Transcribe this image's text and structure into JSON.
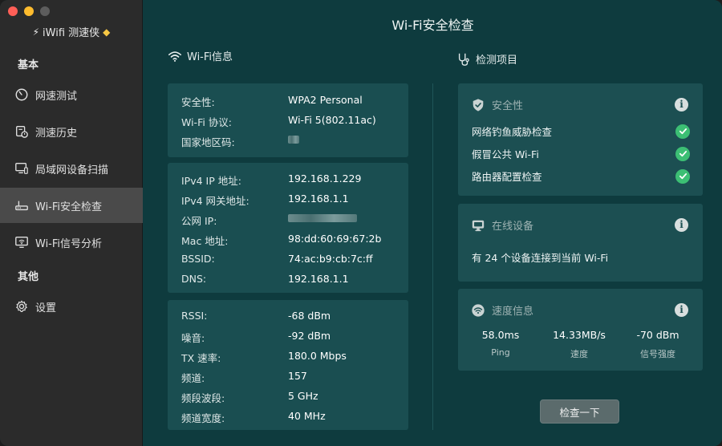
{
  "app": {
    "name": "iWifi 测速侠",
    "colors": {
      "sidebar": "#2b2b2b",
      "main": "#0e3b3e",
      "card": "#1a4e51",
      "ok": "#3cbf74",
      "accent_gold": "#f6c744"
    }
  },
  "sidebar": {
    "section_basic": "基本",
    "section_other": "其他",
    "items": [
      {
        "label": "网速测试",
        "icon": "speedometer-icon"
      },
      {
        "label": "测速历史",
        "icon": "history-icon"
      },
      {
        "label": "局域网设备扫描",
        "icon": "monitor-icon"
      },
      {
        "label": "Wi-Fi安全检查",
        "icon": "router-icon",
        "active": true
      },
      {
        "label": "Wi-Fi信号分析",
        "icon": "wifi-monitor-icon"
      }
    ],
    "settings": {
      "label": "设置",
      "icon": "gear-icon"
    }
  },
  "main": {
    "title": "Wi-Fi安全检查",
    "left_title": "Wi-Fi信息",
    "right_title": "检测项目",
    "info_groups": [
      [
        {
          "key": "安全性:",
          "value": "WPA2 Personal"
        },
        {
          "key": "Wi-Fi 协议:",
          "value": "Wi-Fi 5(802.11ac)"
        },
        {
          "key": "国家地区码:",
          "value": ""
        }
      ],
      [
        {
          "key": "IPv4 IP 地址:",
          "value": "192.168.1.229"
        },
        {
          "key": "IPv4 网关地址:",
          "value": "192.168.1.1"
        },
        {
          "key": "公网 IP:",
          "value": ""
        },
        {
          "key": "Mac 地址:",
          "value": "98:dd:60:69:67:2b"
        },
        {
          "key": "BSSID:",
          "value": "74:ac:b9:cb:7c:ff"
        },
        {
          "key": "DNS:",
          "value": "192.168.1.1"
        }
      ],
      [
        {
          "key": "RSSI:",
          "value": "-68 dBm"
        },
        {
          "key": "噪音:",
          "value": "-92 dBm"
        },
        {
          "key": "TX 速率:",
          "value": "180.0 Mbps"
        },
        {
          "key": "频道:",
          "value": "157"
        },
        {
          "key": "频段波段:",
          "value": "5 GHz"
        },
        {
          "key": "频道宽度:",
          "value": "40 MHz"
        }
      ]
    ],
    "security": {
      "title": "安全性",
      "checks": [
        "网络钓鱼威胁检查",
        "假冒公共 Wi-Fi",
        "路由器配置检查"
      ]
    },
    "devices": {
      "title": "在线设备",
      "text": "有 24 个设备连接到当前 Wi-Fi"
    },
    "speed": {
      "title": "速度信息",
      "stats": [
        {
          "value": "58.0ms",
          "label": "Ping"
        },
        {
          "value": "14.33MB/s",
          "label": "速度"
        },
        {
          "value": "-70 dBm",
          "label": "信号强度"
        }
      ]
    },
    "button": "检查一下"
  }
}
